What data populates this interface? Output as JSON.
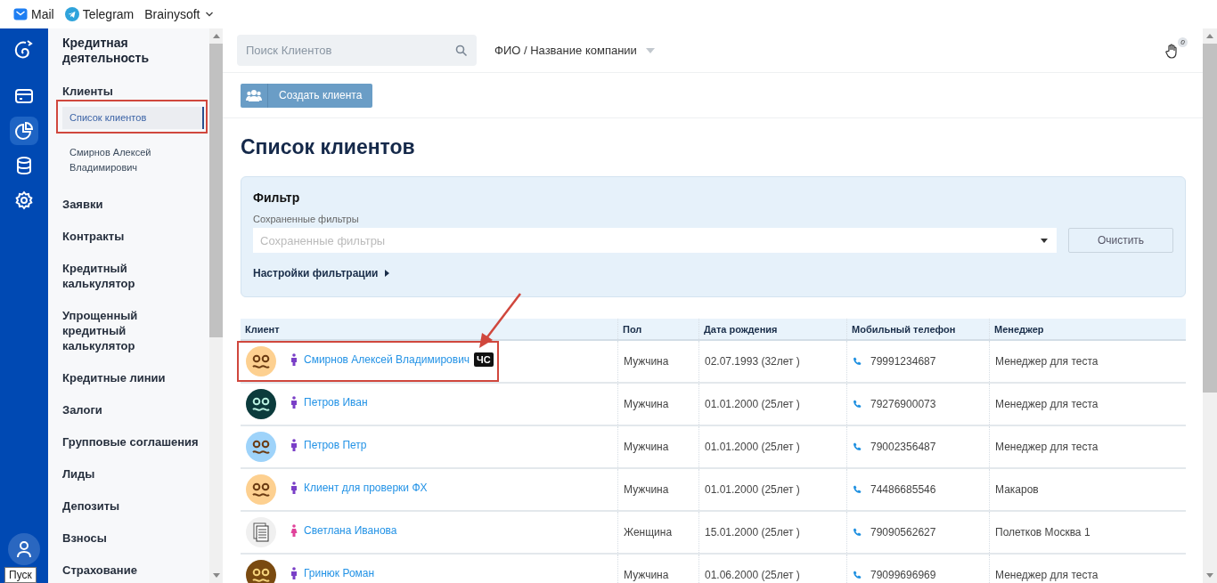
{
  "topbar": {
    "links": [
      {
        "kind": "mail",
        "label": "Mail"
      },
      {
        "kind": "telegram",
        "label": "Telegram"
      },
      {
        "kind": "menu",
        "label": "Brainysoft"
      }
    ]
  },
  "rail": {
    "items": [
      {
        "selected": false
      },
      {
        "selected": true
      },
      {
        "selected": false
      },
      {
        "selected": false
      }
    ],
    "tooltip": "Пуск"
  },
  "sidebar": {
    "heading": "Кредитная деятельность",
    "items": [
      {
        "label": "Клиенты",
        "children": [
          {
            "label": "Список клиентов",
            "selected": true,
            "highlighted": true
          },
          {
            "label": "Смирнов Алексей Владимирович",
            "selected": false,
            "highlighted": false
          }
        ]
      },
      {
        "label": "Заявки"
      },
      {
        "label": "Контракты"
      },
      {
        "label": "Кредитный калькулятор"
      },
      {
        "label": "Упрощенный кредитный калькулятор"
      },
      {
        "label": "Кредитные линии"
      },
      {
        "label": "Залоги"
      },
      {
        "label": "Групповые соглашения"
      },
      {
        "label": "Лиды"
      },
      {
        "label": "Депозиты"
      },
      {
        "label": "Взносы"
      },
      {
        "label": "Страхование"
      }
    ]
  },
  "header": {
    "search": {
      "placeholder": "Поиск Клиентов"
    },
    "search_mode": "ФИО / Название компании",
    "notifications": "0"
  },
  "toolbar": {
    "create_button": "Создать клиента"
  },
  "title": "Список клиентов",
  "filter": {
    "title": "Фильтр",
    "saved_label": "Сохраненные фильтры",
    "saved": {
      "placeholder": "Сохраненные фильтры"
    },
    "clear_button": "Очистить",
    "settings_link": "Настройки фильтрации"
  },
  "table": {
    "columns": [
      "Клиент",
      "Пол",
      "Дата рождения",
      "Мобильный телефон",
      "Менеджер"
    ],
    "rows": [
      {
        "avatar": {
          "kind": "face",
          "color": "#fdd090"
        },
        "kind": "male",
        "client": "Смирнов Алексей Владимирович",
        "badge": "ЧС",
        "highlighted": true,
        "gender": "Мужчина",
        "birth": "02.07.1993 (32лет )",
        "phone": "79991234687",
        "manager": "Менеджер для теста"
      },
      {
        "avatar": {
          "kind": "face",
          "color": "#0b3b3c"
        },
        "kind": "male",
        "client": "Петров Иван",
        "highlighted": false,
        "gender": "Мужчина",
        "birth": "01.01.2000 (25лет )",
        "phone": "79276900073",
        "manager": "Менеджер для теста"
      },
      {
        "avatar": {
          "kind": "face",
          "color": "#9ed3fa"
        },
        "kind": "male",
        "client": "Петров Петр",
        "highlighted": false,
        "gender": "Мужчина",
        "birth": "01.01.2000 (25лет )",
        "phone": "79002356487",
        "manager": "Менеджер для теста"
      },
      {
        "avatar": {
          "kind": "face",
          "color": "#fdd090"
        },
        "kind": "male",
        "client": "Клиент для проверки ФХ",
        "highlighted": false,
        "gender": "Мужчина",
        "birth": "01.01.2000 (25лет )",
        "phone": "74486685546",
        "manager": "Макаров"
      },
      {
        "avatar": {
          "kind": "document"
        },
        "kind": "female",
        "client": "Светлана Иванова",
        "highlighted": false,
        "gender": "Женщина",
        "birth": "15.01.2000 (25лет )",
        "phone": "79090562627",
        "manager": "Полетков Москва 1"
      },
      {
        "avatar": {
          "kind": "face",
          "color": "#7a4a10"
        },
        "kind": "male",
        "client": "Гринюк Роман",
        "highlighted": false,
        "gender": "Мужчина",
        "birth": "01.06.2000 (25лет )",
        "phone": "79099696969",
        "manager": "Менеджер для теста"
      }
    ]
  }
}
